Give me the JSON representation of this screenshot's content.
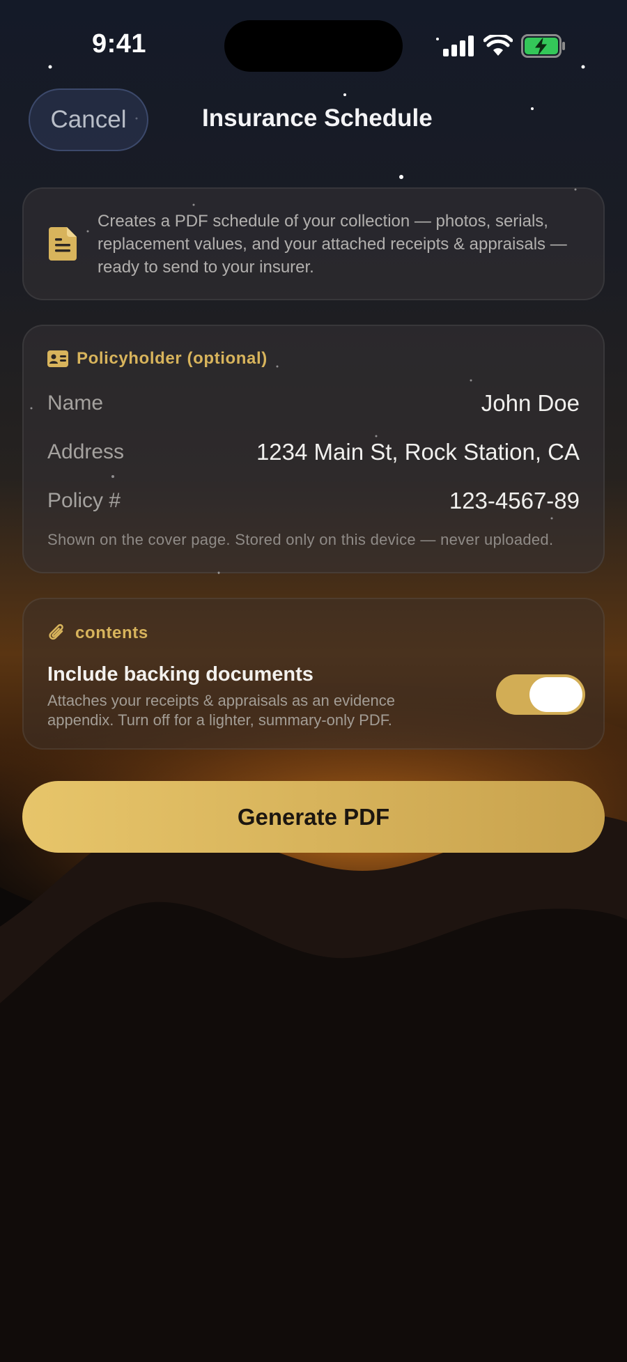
{
  "status_bar": {
    "time": "9:41"
  },
  "nav": {
    "cancel_label": "Cancel",
    "title": "Insurance Schedule"
  },
  "info": {
    "text": "Creates a PDF schedule of your collection — photos, serials, replacement values, and your attached receipts & appraisals — ready to send to your insurer."
  },
  "policyholder": {
    "heading": "Policyholder (optional)",
    "fields": [
      {
        "label": "Name",
        "value": "John Doe"
      },
      {
        "label": "Address",
        "value": "1234 Main St, Rock Station, CA"
      },
      {
        "label": "Policy #",
        "value": "123-4567-89"
      }
    ],
    "note": "Shown on the cover page. Stored only on this device — never uploaded."
  },
  "contents": {
    "heading": "contents",
    "toggle_title": "Include backing documents",
    "toggle_description": "Attaches your receipts & appraisals as an evidence appendix. Turn off for a lighter, summary-only PDF.",
    "toggle_on": true
  },
  "generate_label": "Generate PDF",
  "colors": {
    "accent": "#d8b45c",
    "battery": "#34c759"
  },
  "icons": [
    "document-icon",
    "id-card-icon",
    "paperclip-icon",
    "signal-icon",
    "wifi-icon",
    "battery-charging-icon"
  ]
}
